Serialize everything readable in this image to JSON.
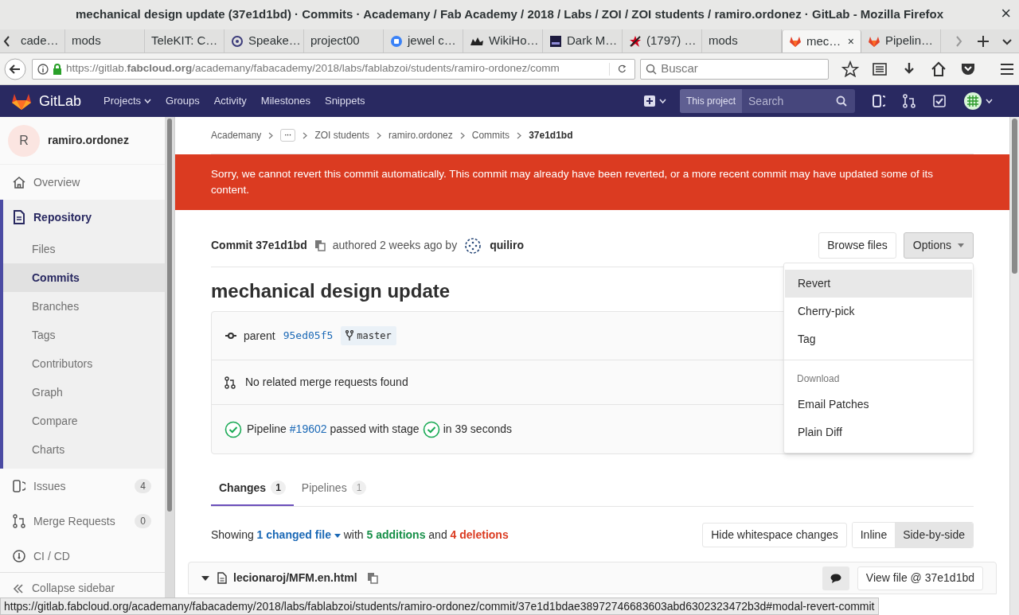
{
  "window": {
    "title": "mechanical design update (37e1d1bd) · Commits · Academany / Fab Academy / 2018 / Labs / ZOI / ZOI students / ramiro.ordonez · GitLab - Mozilla Firefox",
    "close": "×"
  },
  "browser_tabs": [
    {
      "label": "cade…",
      "selected": false
    },
    {
      "label": "mods",
      "selected": false
    },
    {
      "label": "TeleKIT: C…",
      "selected": false
    },
    {
      "label": "Speake…",
      "selected": false
    },
    {
      "label": "project00",
      "selected": false
    },
    {
      "label": "jewel c…",
      "selected": false
    },
    {
      "label": "WikiHo…",
      "selected": false
    },
    {
      "label": "Dark M…",
      "selected": false
    },
    {
      "label": "(1797) …",
      "selected": false
    },
    {
      "label": "mods",
      "selected": false
    },
    {
      "label": "mec…",
      "selected": true,
      "close": "×"
    },
    {
      "label": "Pipelin…",
      "selected": false
    }
  ],
  "address_bar": {
    "url": "https://gitlab.**fabcloud.org**/academany/fabacademy/2018/labs/fablabzoi/students/ramiro-ordonez/comm",
    "search_placeholder": "Buscar"
  },
  "gitlab_header": {
    "brand": "GitLab",
    "nav": [
      {
        "label": "Projects",
        "dropdown": true
      },
      {
        "label": "Groups",
        "dropdown": false
      },
      {
        "label": "Activity",
        "dropdown": false
      },
      {
        "label": "Milestones",
        "dropdown": false
      },
      {
        "label": "Snippets",
        "dropdown": false
      }
    ],
    "search_scope": "This project",
    "search_placeholder": "Search"
  },
  "sidebar": {
    "avatar": "R",
    "project": "ramiro.ordonez",
    "items": [
      {
        "label": "Overview",
        "selected": false
      },
      {
        "label": "Repository",
        "selected": true,
        "expanded": true,
        "children": [
          {
            "label": "Files",
            "selected": false
          },
          {
            "label": "Commits",
            "selected": true
          },
          {
            "label": "Branches",
            "selected": false
          },
          {
            "label": "Tags",
            "selected": false
          },
          {
            "label": "Contributors",
            "selected": false
          },
          {
            "label": "Graph",
            "selected": false
          },
          {
            "label": "Compare",
            "selected": false
          },
          {
            "label": "Charts",
            "selected": false
          }
        ]
      },
      {
        "label": "Issues",
        "count": "4",
        "selected": false
      },
      {
        "label": "Merge Requests",
        "count": "0",
        "selected": false
      },
      {
        "label": "CI / CD",
        "selected": false
      }
    ],
    "collapse": "Collapse sidebar"
  },
  "breadcrumbs": [
    {
      "label": "Academany",
      "kind": "link"
    },
    {
      "label": "···",
      "kind": "more"
    },
    {
      "label": "ZOI students",
      "kind": "link"
    },
    {
      "label": "ramiro.ordonez",
      "kind": "link"
    },
    {
      "label": "Commits",
      "kind": "link"
    },
    {
      "label": "37e1d1bd",
      "kind": "current"
    }
  ],
  "alert": "Sorry, we cannot revert this commit automatically. This commit may already have been reverted, or a more recent commit may have updated some of its content.",
  "commit": {
    "label": "Commit",
    "sha": "37e1d1bd",
    "authored": "authored 2 weeks ago by",
    "author": "quiliro",
    "title": "mechanical design update",
    "buttons": [
      {
        "label": "Browse files",
        "kind": "plain"
      },
      {
        "label": "Options",
        "kind": "dropdown",
        "expanded": true
      }
    ],
    "options_menu": [
      {
        "label": "Revert",
        "kind": "item",
        "selected": true
      },
      {
        "label": "Cherry-pick",
        "kind": "item",
        "selected": false
      },
      {
        "label": "Tag",
        "kind": "item",
        "selected": false
      },
      {
        "label": "Download",
        "kind": "header"
      },
      {
        "label": "Email Patches",
        "kind": "item",
        "selected": false
      },
      {
        "label": "Plain Diff",
        "kind": "item",
        "selected": false
      }
    ],
    "parent_label": "parent",
    "parent_sha": "95ed05f5",
    "branch": "master",
    "merge_requests": "No related merge requests found",
    "pipeline": {
      "label": "Pipeline",
      "link": "#19602",
      "middle": "passed with stage",
      "end": "in 39 seconds"
    }
  },
  "tabs": [
    {
      "label": "Changes",
      "count": "1",
      "selected": true
    },
    {
      "label": "Pipelines",
      "count": "1",
      "selected": false
    }
  ],
  "summary": {
    "before": "Showing",
    "link": "1 changed file",
    "middle": "with",
    "additions": "5 additions",
    "and": "and",
    "deletions": "4 deletions"
  },
  "diff_buttons": [
    {
      "label": "Hide whitespace changes",
      "selected": false,
      "group": false
    },
    {
      "label": "Inline",
      "selected": false,
      "group": true
    },
    {
      "label": "Side-by-side",
      "selected": true,
      "group": true
    }
  ],
  "file": {
    "path": "lecionaroj/MFM.en.html",
    "view": "View file @ 37e1d1bd"
  },
  "status_url": "https://gitlab.fabcloud.org/academany/fabacademy/2018/labs/fablabzoi/students/ramiro-ordonez/commit/37e1d1bdae38972746683603abd6302323472b3d#modal-revert-commit"
}
